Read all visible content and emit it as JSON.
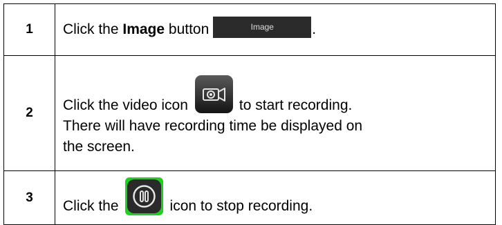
{
  "steps": [
    {
      "number": "1",
      "prefix": "Click the ",
      "bold": "Image",
      "middle": " button",
      "button_label": "Image",
      "suffix": "."
    },
    {
      "number": "2",
      "prefix": "Click the video icon",
      "after_icon": "to start recording.",
      "line2": "There will have recording time be displayed on",
      "line3": "the screen.",
      "icon": "video-camera-icon"
    },
    {
      "number": "3",
      "prefix": "Click the",
      "after_icon": "icon to stop recording.",
      "icon": "pause-stop-icon"
    }
  ],
  "colors": {
    "button_bg": "#2b2b2b",
    "icon_dark": "#1a1a1a",
    "icon_green": "#1fd01f"
  }
}
